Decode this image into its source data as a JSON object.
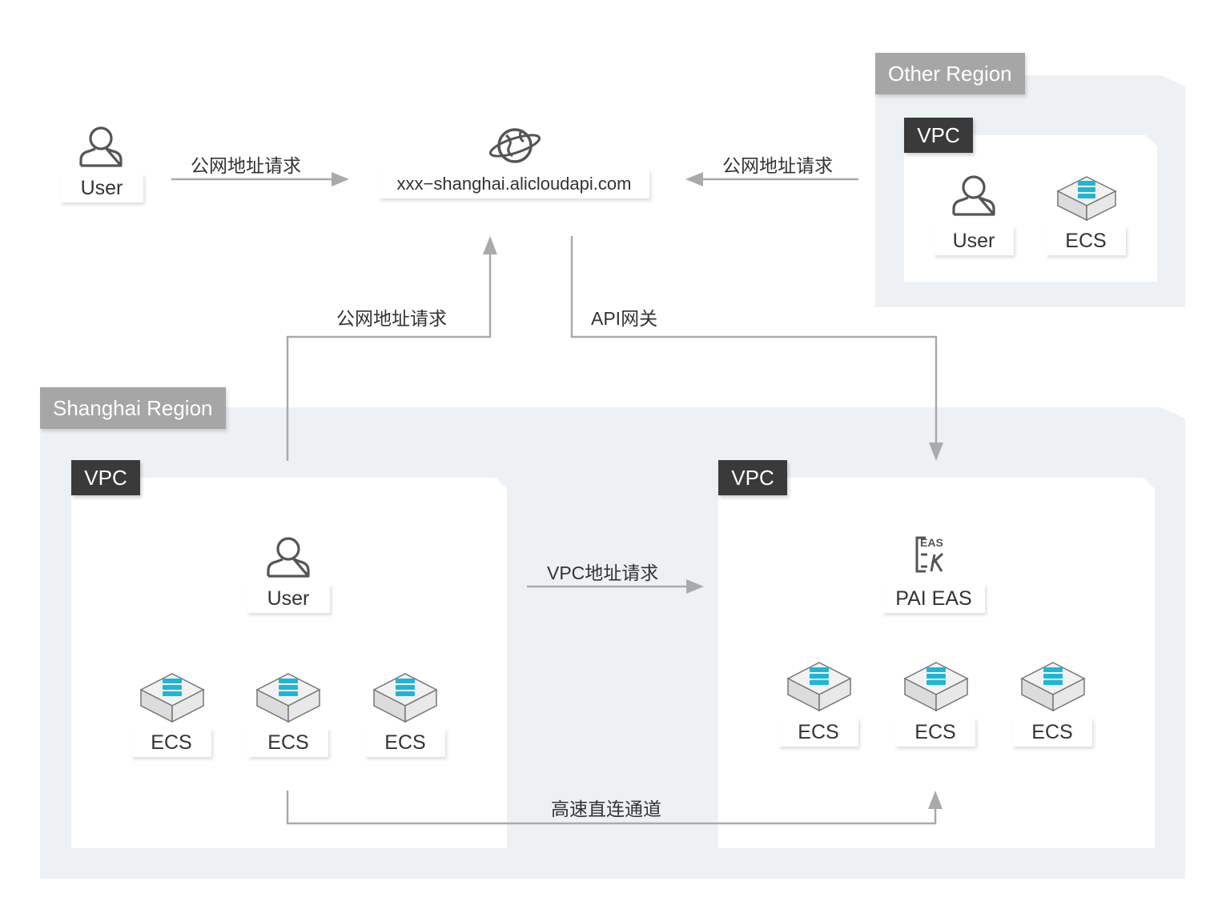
{
  "regions": {
    "other": {
      "label": "Other Region"
    },
    "shanghai": {
      "label": "Shanghai Region"
    }
  },
  "vpc_label": "VPC",
  "top": {
    "user_label": "User",
    "endpoint": "xxx−shanghai.alicloudapi.com"
  },
  "other_vpc": {
    "user_label": "User",
    "ecs_label": "ECS"
  },
  "sh_vpc_left": {
    "user_label": "User",
    "ecs_labels": [
      "ECS",
      "ECS",
      "ECS"
    ]
  },
  "sh_vpc_right": {
    "service_label": "PAI EAS",
    "icon_text": "EAS",
    "ecs_labels": [
      "ECS",
      "ECS",
      "ECS"
    ]
  },
  "edges": {
    "user_to_endpoint": "公网地址请求",
    "other_to_endpoint": "公网地址请求",
    "sh_to_endpoint": "公网地址请求",
    "api_gateway": "API网关",
    "vpc_request": "VPC地址请求",
    "direct_channel": "高速直连通道"
  },
  "colors": {
    "region_bg": "#eef1f4",
    "region_tag": "#a6a6a6",
    "vpc_tag": "#3a3a3a",
    "ecs_accent": "#1fb6d6",
    "line": "#aaaaaa"
  }
}
